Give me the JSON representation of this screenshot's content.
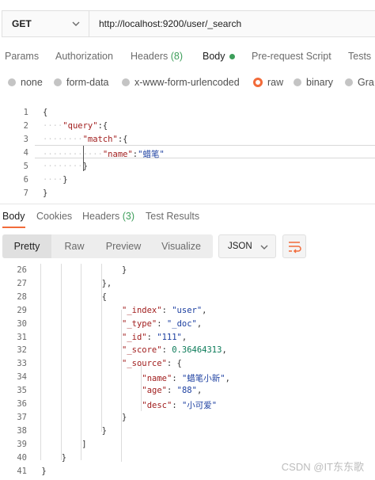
{
  "request": {
    "method": "GET",
    "url": "http://localhost:9200/user/_search"
  },
  "request_tabs": [
    "Params",
    "Authorization",
    "Headers",
    "(8)",
    "Body",
    "Pre-request Script",
    "Tests"
  ],
  "body_types": {
    "options": [
      "none",
      "form-data",
      "x-www-form-urlencoded",
      "raw",
      "binary",
      "Gra"
    ],
    "selected": "raw"
  },
  "request_body_lines": [
    {
      "n": "1",
      "indent": "",
      "parts": [
        [
          "p",
          "{"
        ]
      ]
    },
    {
      "n": "2",
      "indent": "····",
      "parts": [
        [
          "k",
          "\"query\""
        ],
        [
          "p",
          ":{"
        ]
      ]
    },
    {
      "n": "3",
      "indent": "········",
      "parts": [
        [
          "k",
          "\"match\""
        ],
        [
          "p",
          ":{"
        ]
      ]
    },
    {
      "n": "4",
      "indent": "············",
      "parts": [
        [
          "k",
          "\"name\""
        ],
        [
          "p",
          ":"
        ],
        [
          "s",
          "\"蜡笔\""
        ]
      ]
    },
    {
      "n": "5",
      "indent": "········",
      "parts": [
        [
          "p",
          "}"
        ]
      ]
    },
    {
      "n": "6",
      "indent": "····",
      "parts": [
        [
          "p",
          "}"
        ]
      ]
    },
    {
      "n": "7",
      "indent": "",
      "parts": [
        [
          "p",
          "}"
        ]
      ]
    }
  ],
  "response_tabs": [
    "Body",
    "Cookies",
    "Headers",
    "(3)",
    "Test Results"
  ],
  "view_modes": [
    "Pretty",
    "Raw",
    "Preview",
    "Visualize"
  ],
  "format": "JSON",
  "response_lines": [
    {
      "n": "26",
      "level": 5,
      "parts": [
        [
          "p",
          "}"
        ]
      ]
    },
    {
      "n": "27",
      "level": 4,
      "parts": [
        [
          "p",
          "},"
        ]
      ]
    },
    {
      "n": "28",
      "level": 4,
      "parts": [
        [
          "p",
          "{"
        ]
      ]
    },
    {
      "n": "29",
      "level": 5,
      "parts": [
        [
          "k",
          "\"_index\""
        ],
        [
          "p",
          ": "
        ],
        [
          "s",
          "\"user\""
        ],
        [
          "p",
          ","
        ]
      ]
    },
    {
      "n": "30",
      "level": 5,
      "parts": [
        [
          "k",
          "\"_type\""
        ],
        [
          "p",
          ": "
        ],
        [
          "s",
          "\"_doc\""
        ],
        [
          "p",
          ","
        ]
      ]
    },
    {
      "n": "31",
      "level": 5,
      "parts": [
        [
          "k",
          "\"_id\""
        ],
        [
          "p",
          ": "
        ],
        [
          "s",
          "\"111\""
        ],
        [
          "p",
          ","
        ]
      ]
    },
    {
      "n": "32",
      "level": 5,
      "parts": [
        [
          "k",
          "\"_score\""
        ],
        [
          "p",
          ": "
        ],
        [
          "n",
          "0.36464313"
        ],
        [
          "p",
          ","
        ]
      ]
    },
    {
      "n": "33",
      "level": 5,
      "parts": [
        [
          "k",
          "\"_source\""
        ],
        [
          "p",
          ": {"
        ]
      ]
    },
    {
      "n": "34",
      "level": 6,
      "parts": [
        [
          "k",
          "\"name\""
        ],
        [
          "p",
          ": "
        ],
        [
          "s",
          "\"蜡笔小新\""
        ],
        [
          "p",
          ","
        ]
      ]
    },
    {
      "n": "35",
      "level": 6,
      "parts": [
        [
          "k",
          "\"age\""
        ],
        [
          "p",
          ": "
        ],
        [
          "s",
          "\"88\""
        ],
        [
          "p",
          ","
        ]
      ]
    },
    {
      "n": "36",
      "level": 6,
      "parts": [
        [
          "k",
          "\"desc\""
        ],
        [
          "p",
          ": "
        ],
        [
          "s",
          "\"小可爱\""
        ]
      ]
    },
    {
      "n": "37",
      "level": 5,
      "parts": [
        [
          "p",
          "}"
        ]
      ]
    },
    {
      "n": "38",
      "level": 4,
      "parts": [
        [
          "p",
          "}"
        ]
      ]
    },
    {
      "n": "39",
      "level": 3,
      "parts": [
        [
          "p",
          "]"
        ]
      ]
    },
    {
      "n": "40",
      "level": 2,
      "parts": [
        [
          "p",
          "}"
        ]
      ]
    },
    {
      "n": "41",
      "level": 1,
      "parts": [
        [
          "p",
          "}"
        ]
      ]
    }
  ],
  "watermark": "CSDN @IT东东歌",
  "colors": {
    "accent": "#f26b3a",
    "green": "#3d9e5a",
    "key": "#a11e1e",
    "string": "#1c3fa0",
    "number": "#0b7a58"
  }
}
